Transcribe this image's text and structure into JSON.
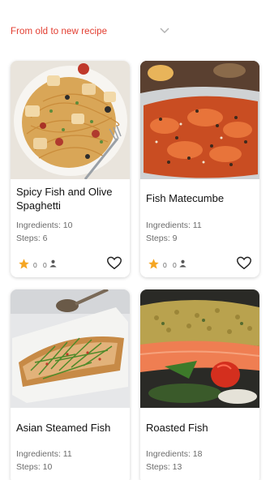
{
  "sort": {
    "label": "From old to new recipe",
    "icon": "chevron-down-icon",
    "accent_color": "#e23b2e"
  },
  "recipes": [
    {
      "title": "Spicy Fish and Olive Spaghetti",
      "ingredients": "Ingredients: 10",
      "steps": "Steps: 6",
      "rating_count": "0",
      "user_count": "0"
    },
    {
      "title": "Fish Matecumbe",
      "ingredients": "Ingredients: 11",
      "steps": "Steps: 9",
      "rating_count": "0",
      "user_count": "0"
    },
    {
      "title": "Asian Steamed Fish",
      "ingredients": "Ingredients: 11",
      "steps": "Steps: 10"
    },
    {
      "title": "Roasted Fish",
      "ingredients": "Ingredients: 18",
      "steps": "Steps: 13"
    }
  ],
  "colors": {
    "star": "#f5a623",
    "text_muted": "#6b6b6b"
  }
}
